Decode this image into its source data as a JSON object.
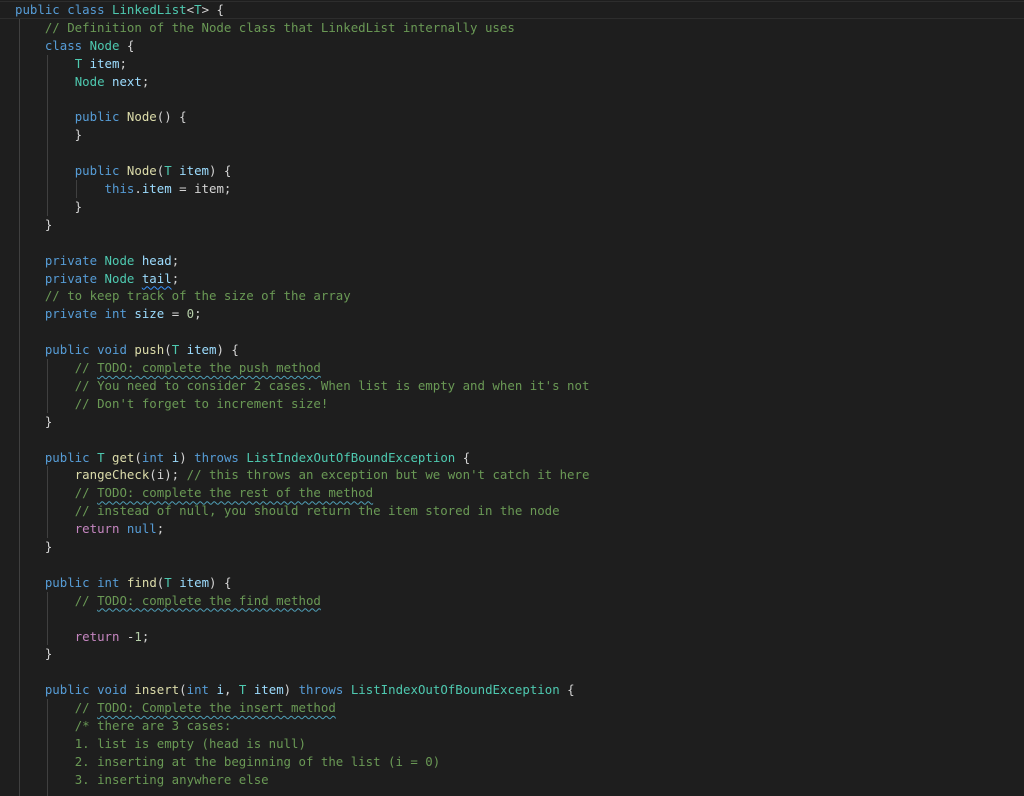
{
  "editor": {
    "language": "Java",
    "file_content_lines": [
      [
        [
          "kw",
          "public"
        ],
        [
          "pl",
          " "
        ],
        [
          "kw",
          "class"
        ],
        [
          "pl",
          " "
        ],
        [
          "type",
          "LinkedList"
        ],
        [
          "pl",
          "<"
        ],
        [
          "type",
          "T"
        ],
        [
          "pl",
          "> {"
        ]
      ],
      [
        [
          "pl",
          "    "
        ],
        [
          "cm",
          "// Definition of the Node class that LinkedList internally uses"
        ]
      ],
      [
        [
          "pl",
          "    "
        ],
        [
          "kw",
          "class"
        ],
        [
          "pl",
          " "
        ],
        [
          "type",
          "Node"
        ],
        [
          "pl",
          " {"
        ]
      ],
      [
        [
          "pl",
          "        "
        ],
        [
          "type",
          "T"
        ],
        [
          "pl",
          " "
        ],
        [
          "var",
          "item"
        ],
        [
          "pl",
          ";"
        ]
      ],
      [
        [
          "pl",
          "        "
        ],
        [
          "type",
          "Node"
        ],
        [
          "pl",
          " "
        ],
        [
          "var",
          "next"
        ],
        [
          "pl",
          ";"
        ]
      ],
      [],
      [
        [
          "pl",
          "        "
        ],
        [
          "kw",
          "public"
        ],
        [
          "pl",
          " "
        ],
        [
          "fn",
          "Node"
        ],
        [
          "pl",
          "() {"
        ]
      ],
      [
        [
          "pl",
          "        }"
        ]
      ],
      [],
      [
        [
          "pl",
          "        "
        ],
        [
          "kw",
          "public"
        ],
        [
          "pl",
          " "
        ],
        [
          "fn",
          "Node"
        ],
        [
          "pl",
          "("
        ],
        [
          "type",
          "T"
        ],
        [
          "pl",
          " "
        ],
        [
          "var",
          "item"
        ],
        [
          "pl",
          ") {"
        ]
      ],
      [
        [
          "pl",
          "            "
        ],
        [
          "kw",
          "this"
        ],
        [
          "pl",
          "."
        ],
        [
          "var",
          "item"
        ],
        [
          "pl",
          " = item;"
        ]
      ],
      [
        [
          "pl",
          "        }"
        ]
      ],
      [
        [
          "pl",
          "    }"
        ]
      ],
      [],
      [
        [
          "pl",
          "    "
        ],
        [
          "kw",
          "private"
        ],
        [
          "pl",
          " "
        ],
        [
          "type",
          "Node"
        ],
        [
          "pl",
          " "
        ],
        [
          "var",
          "head"
        ],
        [
          "pl",
          ";"
        ]
      ],
      [
        [
          "pl",
          "    "
        ],
        [
          "kw",
          "private"
        ],
        [
          "pl",
          " "
        ],
        [
          "type",
          "Node"
        ],
        [
          "pl",
          " "
        ],
        [
          "var sq-blue",
          "tail"
        ],
        [
          "pl",
          ";"
        ]
      ],
      [
        [
          "pl",
          "    "
        ],
        [
          "cm",
          "// to keep track of the size of the array"
        ]
      ],
      [
        [
          "pl",
          "    "
        ],
        [
          "kw",
          "private"
        ],
        [
          "pl",
          " "
        ],
        [
          "kw",
          "int"
        ],
        [
          "pl",
          " "
        ],
        [
          "var",
          "size"
        ],
        [
          "pl",
          " = "
        ],
        [
          "num",
          "0"
        ],
        [
          "pl",
          ";"
        ]
      ],
      [],
      [
        [
          "pl",
          "    "
        ],
        [
          "kw",
          "public"
        ],
        [
          "pl",
          " "
        ],
        [
          "kw",
          "void"
        ],
        [
          "pl",
          " "
        ],
        [
          "fn",
          "push"
        ],
        [
          "pl",
          "("
        ],
        [
          "type",
          "T"
        ],
        [
          "pl",
          " "
        ],
        [
          "var",
          "item"
        ],
        [
          "pl",
          ") {"
        ]
      ],
      [
        [
          "pl",
          "        "
        ],
        [
          "cm",
          "// "
        ],
        [
          "cm sq-green",
          "TODO: complete the push method"
        ]
      ],
      [
        [
          "pl",
          "        "
        ],
        [
          "cm",
          "// You need to consider 2 cases. When list is empty and when it's not"
        ]
      ],
      [
        [
          "pl",
          "        "
        ],
        [
          "cm",
          "// Don't forget to increment size!"
        ]
      ],
      [
        [
          "pl",
          "    }"
        ]
      ],
      [],
      [
        [
          "pl",
          "    "
        ],
        [
          "kw",
          "public"
        ],
        [
          "pl",
          " "
        ],
        [
          "type",
          "T"
        ],
        [
          "pl",
          " "
        ],
        [
          "fn",
          "get"
        ],
        [
          "pl",
          "("
        ],
        [
          "kw",
          "int"
        ],
        [
          "pl",
          " "
        ],
        [
          "var",
          "i"
        ],
        [
          "pl",
          ") "
        ],
        [
          "kw",
          "throws"
        ],
        [
          "pl",
          " "
        ],
        [
          "type",
          "ListIndexOutOfBoundException"
        ],
        [
          "pl",
          " {"
        ]
      ],
      [
        [
          "pl",
          "        "
        ],
        [
          "fn",
          "rangeCheck"
        ],
        [
          "pl",
          "(i); "
        ],
        [
          "cm",
          "// this throws an exception but we won't catch it here"
        ]
      ],
      [
        [
          "pl",
          "        "
        ],
        [
          "cm",
          "// "
        ],
        [
          "cm sq-green",
          "TODO: complete the rest of the method"
        ]
      ],
      [
        [
          "pl",
          "        "
        ],
        [
          "cm",
          "// instead of null, you should return the item stored in the node"
        ]
      ],
      [
        [
          "pl",
          "        "
        ],
        [
          "ctl",
          "return"
        ],
        [
          "pl",
          " "
        ],
        [
          "kw",
          "null"
        ],
        [
          "pl",
          ";"
        ]
      ],
      [
        [
          "pl",
          "    }"
        ]
      ],
      [],
      [
        [
          "pl",
          "    "
        ],
        [
          "kw",
          "public"
        ],
        [
          "pl",
          " "
        ],
        [
          "kw",
          "int"
        ],
        [
          "pl",
          " "
        ],
        [
          "fn",
          "find"
        ],
        [
          "pl",
          "("
        ],
        [
          "type",
          "T"
        ],
        [
          "pl",
          " "
        ],
        [
          "var",
          "item"
        ],
        [
          "pl",
          ") {"
        ]
      ],
      [
        [
          "pl",
          "        "
        ],
        [
          "cm",
          "// "
        ],
        [
          "cm sq-green",
          "TODO: complete the find method"
        ]
      ],
      [],
      [
        [
          "pl",
          "        "
        ],
        [
          "ctl",
          "return"
        ],
        [
          "pl",
          " -"
        ],
        [
          "num",
          "1"
        ],
        [
          "pl",
          ";"
        ]
      ],
      [
        [
          "pl",
          "    }"
        ]
      ],
      [],
      [
        [
          "pl",
          "    "
        ],
        [
          "kw",
          "public"
        ],
        [
          "pl",
          " "
        ],
        [
          "kw",
          "void"
        ],
        [
          "pl",
          " "
        ],
        [
          "fn",
          "insert"
        ],
        [
          "pl",
          "("
        ],
        [
          "kw",
          "int"
        ],
        [
          "pl",
          " "
        ],
        [
          "var",
          "i"
        ],
        [
          "pl",
          ", "
        ],
        [
          "type",
          "T"
        ],
        [
          "pl",
          " "
        ],
        [
          "var",
          "item"
        ],
        [
          "pl",
          ") "
        ],
        [
          "kw",
          "throws"
        ],
        [
          "pl",
          " "
        ],
        [
          "type",
          "ListIndexOutOfBoundException"
        ],
        [
          "pl",
          " {"
        ]
      ],
      [
        [
          "pl",
          "        "
        ],
        [
          "cm",
          "// "
        ],
        [
          "cm sq-green",
          "TODO: Complete the insert method"
        ]
      ],
      [
        [
          "pl",
          "        "
        ],
        [
          "cm",
          "/* there are 3 cases:"
        ]
      ],
      [
        [
          "pl",
          "        "
        ],
        [
          "cm",
          "1. list is empty (head is null)"
        ]
      ],
      [
        [
          "pl",
          "        "
        ],
        [
          "cm",
          "2. inserting at the beginning of the list (i = 0)"
        ]
      ],
      [
        [
          "pl",
          "        "
        ],
        [
          "cm",
          "3. inserting anywhere else"
        ]
      ]
    ]
  }
}
